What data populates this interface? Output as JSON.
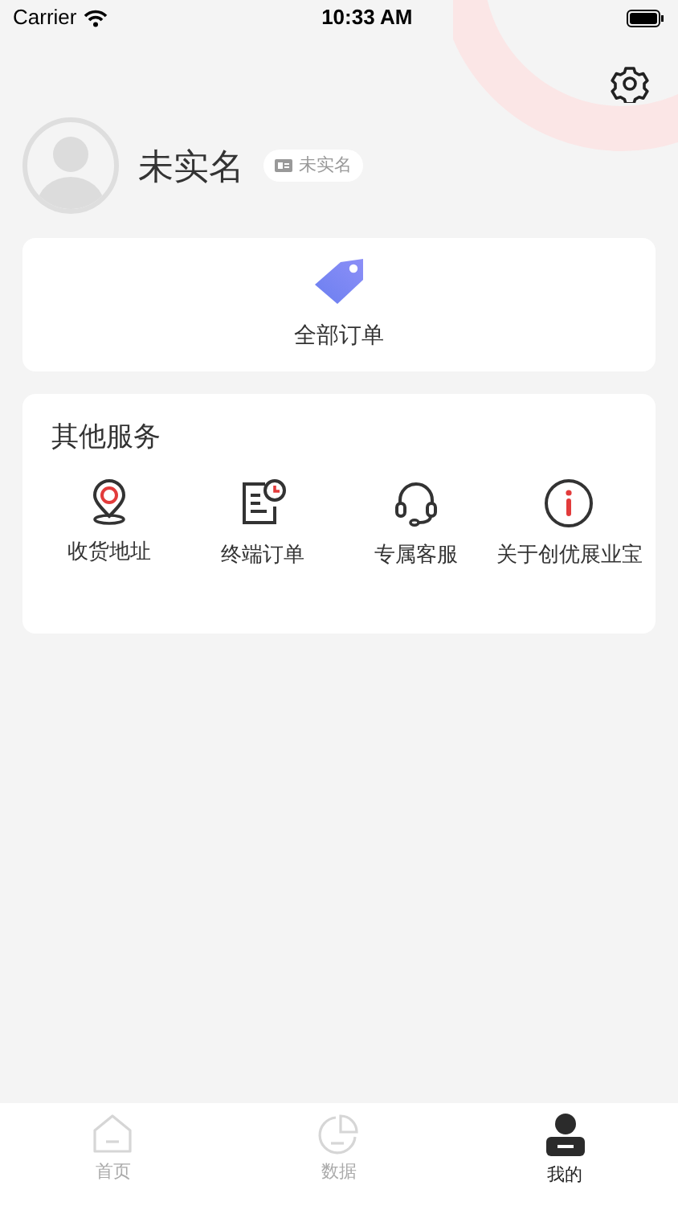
{
  "status_bar": {
    "carrier": "Carrier",
    "time": "10:33 AM"
  },
  "profile": {
    "name": "未实名",
    "badge": "未实名"
  },
  "orders": {
    "label": "全部订单"
  },
  "services": {
    "title": "其他服务",
    "items": [
      {
        "kind": "address",
        "label": "收货地址"
      },
      {
        "kind": "terminal",
        "label": "终端订单"
      },
      {
        "kind": "support",
        "label": "专属客服"
      },
      {
        "kind": "about",
        "label": "关于创优展业宝"
      }
    ]
  },
  "tabs": [
    {
      "kind": "home",
      "label": "首页",
      "selected": false
    },
    {
      "kind": "data",
      "label": "数据",
      "selected": false
    },
    {
      "kind": "me",
      "label": "我的",
      "selected": true
    }
  ]
}
